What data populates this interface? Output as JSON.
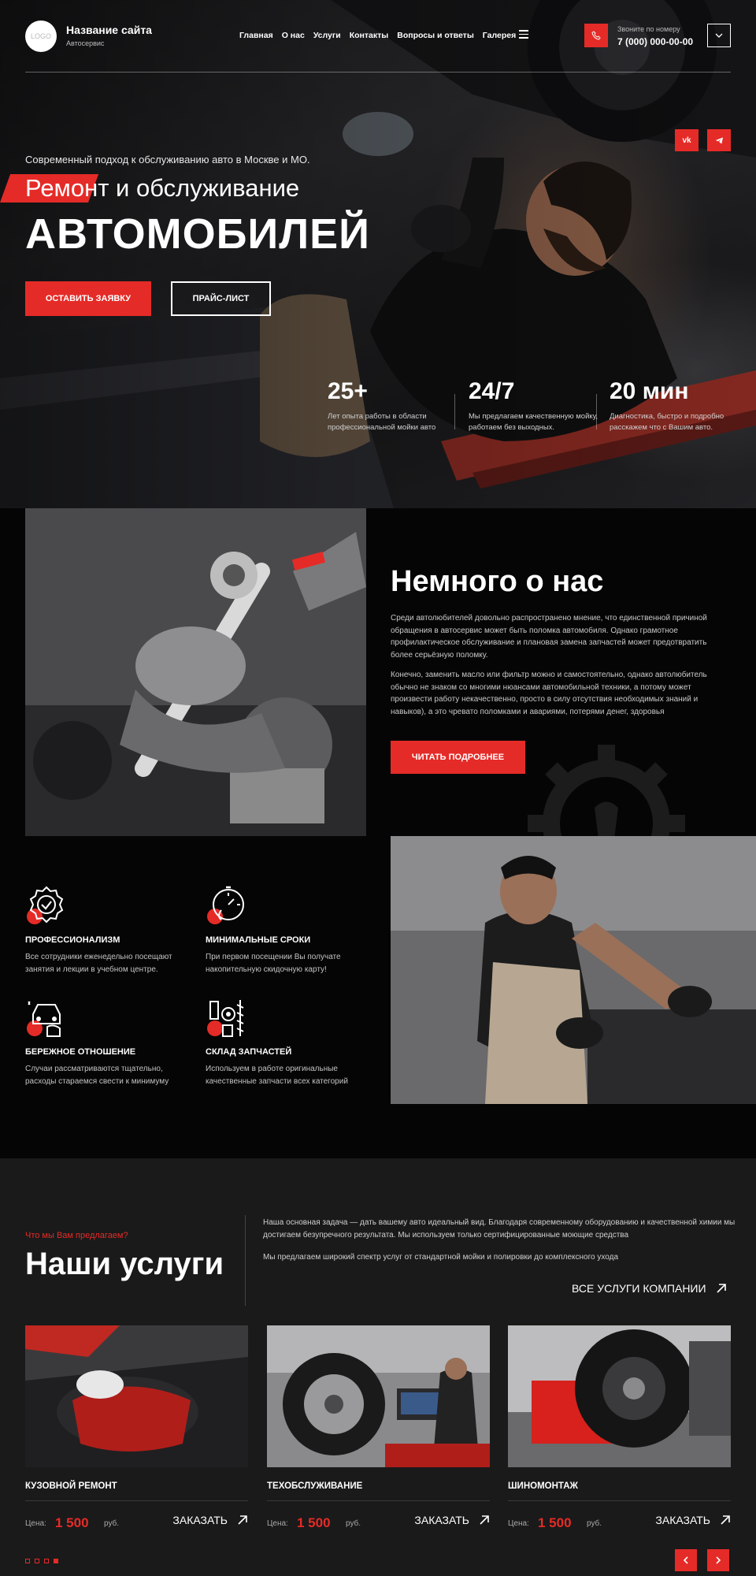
{
  "header": {
    "logo_text": "LOGO",
    "site_name": "Название сайта",
    "site_subtitle": "Автосервис",
    "nav": [
      "Главная",
      "О нас",
      "Услуги",
      "Контакты",
      "Вопросы и ответы",
      "Галерея"
    ],
    "phone_label": "Звоните по номеру",
    "phone_number": "7 (000) 000-00-00"
  },
  "hero": {
    "kicker": "Современный подход к обслуживанию авто в Москве и МО.",
    "title_line1": "Ремонт и обслуживание",
    "title_line2": "АВТОМОБИЛЕЙ",
    "primary_button": "ОСТАВИТЬ ЗАЯВКУ",
    "secondary_button": "ПРАЙС-ЛИСТ",
    "social": [
      "vk-icon",
      "telegram-icon"
    ],
    "stats": [
      {
        "value": "25+",
        "text": "Лет опыта работы в области профессиональной мойки авто"
      },
      {
        "value": "24/7",
        "text": "Мы предлагаем качественную мойку, работаем без выходных."
      },
      {
        "value": "20 мин",
        "text": "Диагностика, быстро и подробно расскажем что с Вашим авто."
      }
    ]
  },
  "about": {
    "title": "Немного о нас",
    "p1": "Среди автолюбителей довольно распространено мнение, что единственной причиной обращения в автосервис может быть поломка автомобиля. Однако грамотное профилактическое обслуживание и плановая замена запчастей может предотвратить более серьёзную поломку.",
    "p2": "Конечно, заменить масло или фильтр можно и самостоятельно, однако автолюбитель обычно не знаком со многими нюансами автомобильной техники, а потому может произвести работу некачественно, просто в силу отсутствия необходимых знаний и навыков), а это чревато поломками и авариями, потерями денег, здоровья",
    "button": "ЧИТАТЬ ПОДРОБНЕЕ",
    "features": [
      {
        "icon": "badge-check-icon",
        "title": "ПРОФЕССИОНАЛИЗМ",
        "text": "Все сотрудники еженедельно посещают занятия и лекции в учебном центре."
      },
      {
        "icon": "stopwatch-icon",
        "title": "МИНИМАЛЬНЫЕ СРОКИ",
        "text": "При первом посещении Вы получате накопительную скидочную карту!"
      },
      {
        "icon": "car-care-icon",
        "title": "БЕРЕЖНОЕ ОТНОШЕНИЕ",
        "text": "Случаи рассматриваются  тщательно, расходы стараемся свести к минимуму"
      },
      {
        "icon": "spare-parts-icon",
        "title": "СКЛАД ЗАПЧАСТЕЙ",
        "text": "Используем в работе оригинальные качественные запчасти всех категорий"
      }
    ]
  },
  "services": {
    "kicker": "Что мы Вам предлагаем?",
    "title": "Наши услуги",
    "desc1": "Наша основная задача — дать вашему авто идеальный вид. Благодаря современному оборудованию и качественной химии мы достигаем безупречного результата. Мы используем только сертифицированные моющие средства",
    "desc2": "Мы предлагаем широкий спектр услуг от стандартной мойки и полировки до комплексного ухода",
    "all_link": "ВСЕ УСЛУГИ КОМПАНИИ",
    "price_label": "Цена:",
    "currency": "руб.",
    "order_label": "ЗАКАЗАТЬ",
    "cards": [
      {
        "title": "КУЗОВНОЙ РЕМОНТ",
        "price": "1 500"
      },
      {
        "title": "ТЕХОБСЛУЖИВАНИЕ",
        "price": "1 500"
      },
      {
        "title": "ШИНОМОНТАЖ",
        "price": "1 500"
      }
    ],
    "pager_count": 4,
    "pager_active": 4
  },
  "colors": {
    "accent": "#e52b27",
    "background": "#050505",
    "services_bg": "#1a1a1a"
  }
}
